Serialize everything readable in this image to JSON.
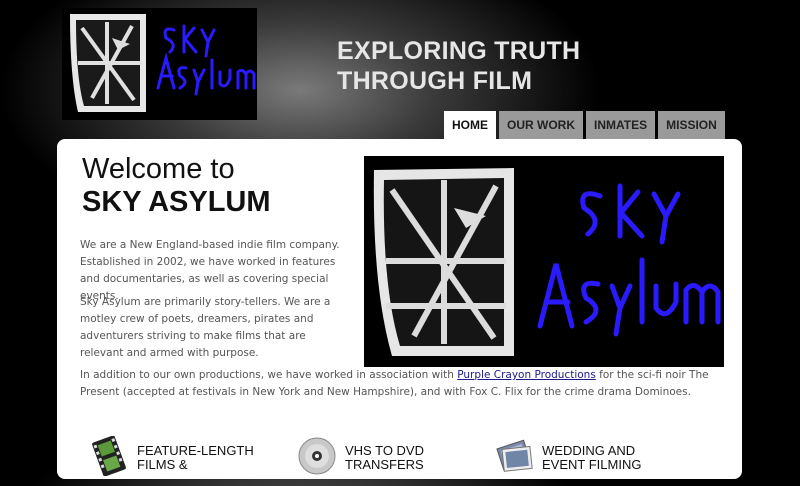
{
  "header": {
    "tagline": "EXPLORING TRUTH THROUGH FILM"
  },
  "nav": {
    "tabs": [
      {
        "label": "HOME",
        "active": true
      },
      {
        "label": "OUR WORK",
        "active": false
      },
      {
        "label": "INMATES",
        "active": false
      },
      {
        "label": "MISSION",
        "active": false
      }
    ]
  },
  "main": {
    "welcome_line1": "Welcome to",
    "welcome_line2": "SKY ASYLUM",
    "paragraph1": "We are a New England-based indie film company. Established in 2002, we have worked in features and documentaries, as well as covering special events.",
    "paragraph2": "Sky Asylum are primarily story-tellers. We are a motley crew of poets, dreamers, pirates and adventurers striving to make films that are relevant and armed with purpose.",
    "paragraph3_before": "In addition to our own productions, we have worked in association with ",
    "paragraph3_link": "Purple Crayon Productions",
    "paragraph3_after": " for the sci-fi noir The Present (accepted at festivals in New York and New Hampshire), and with Fox C. Flix for the crime drama Dominoes."
  },
  "services": [
    {
      "label": "FEATURE-LENGTH FILMS &",
      "icon": "film-strip-icon"
    },
    {
      "label": "VHS TO DVD TRANSFERS",
      "icon": "dvd-disc-icon"
    },
    {
      "label": "WEDDING AND EVENT FILMING",
      "icon": "photos-icon"
    }
  ],
  "colors": {
    "logo_text": "#2a1aff",
    "content_bg": "#ffffff",
    "tab_inactive": "#9a9a9a",
    "link": "#1a1a8c"
  }
}
